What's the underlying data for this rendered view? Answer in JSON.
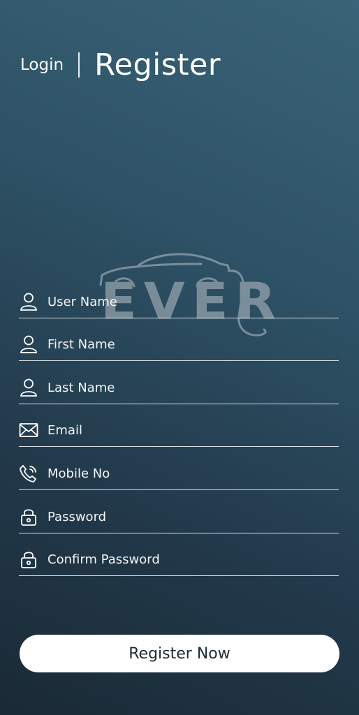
{
  "header": {
    "login_label": "Login",
    "register_label": "Register"
  },
  "logo": {
    "text": "EVER"
  },
  "form": {
    "fields": [
      {
        "placeholder": "User Name",
        "icon": "user-icon"
      },
      {
        "placeholder": "First Name",
        "icon": "user-icon"
      },
      {
        "placeholder": "Last Name",
        "icon": "user-icon"
      },
      {
        "placeholder": "Email",
        "icon": "mail-icon"
      },
      {
        "placeholder": "Mobile No",
        "icon": "phone-icon"
      },
      {
        "placeholder": "Password",
        "icon": "lock-icon"
      },
      {
        "placeholder": "Confirm Password",
        "icon": "lock-icon"
      }
    ],
    "submit_label": "Register Now"
  },
  "colors": {
    "background_top": "#3a6378",
    "background_bottom": "#1a2a36",
    "button_bg": "#ffffff",
    "button_text": "#1f2c34"
  }
}
